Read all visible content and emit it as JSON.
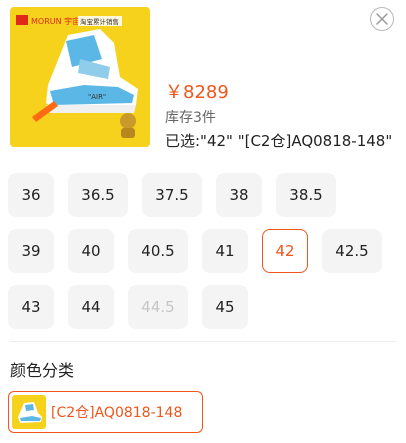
{
  "product": {
    "brand_text": "MORUN 宇宙",
    "shop_text": "淘宝累计销售",
    "price": "￥8289",
    "stock": "库存3件",
    "selected": "已选:\"42\" \"[C2仓]AQ0818-148\""
  },
  "sizes": {
    "rows": [
      [
        {
          "label": "36"
        },
        {
          "label": "36.5"
        },
        {
          "label": "37.5"
        },
        {
          "label": "38"
        },
        {
          "label": "38.5"
        }
      ],
      [
        {
          "label": "39"
        },
        {
          "label": "40"
        },
        {
          "label": "40.5"
        },
        {
          "label": "41"
        },
        {
          "label": "42",
          "state": "selected"
        },
        {
          "label": "42.5"
        }
      ],
      [
        {
          "label": "43"
        },
        {
          "label": "44"
        },
        {
          "label": "44.5",
          "state": "disabled"
        },
        {
          "label": "45"
        }
      ]
    ]
  },
  "color_section": {
    "title": "颜色分类",
    "option": "[C2仓]AQ0818-148"
  },
  "colors": {
    "accent": "#f0551b",
    "button_bg": "#f4f4f4",
    "disabled_text": "#c6c6c6"
  }
}
